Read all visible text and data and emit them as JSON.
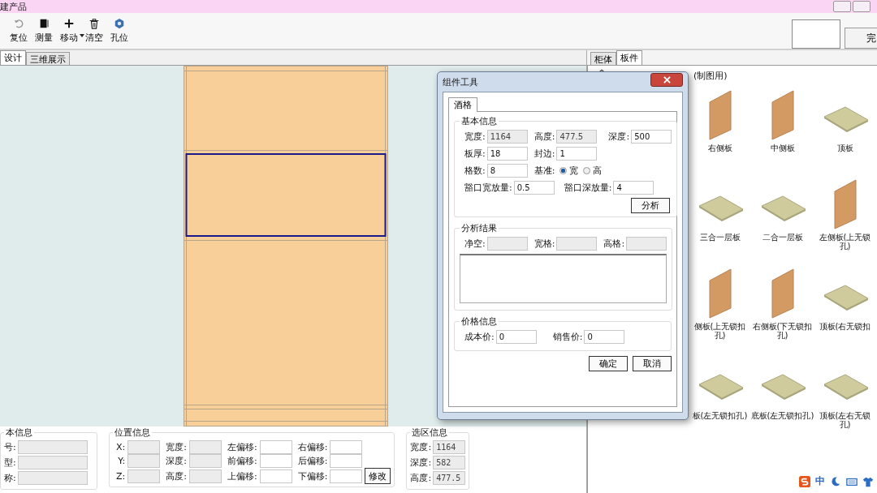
{
  "window": {
    "title": "建产品"
  },
  "toolbar": [
    {
      "label": "复位",
      "dropdown": false
    },
    {
      "label": "测量",
      "dropdown": false
    },
    {
      "label": "移动",
      "dropdown": true
    },
    {
      "label": "清空",
      "dropdown": false
    },
    {
      "label": "孔位",
      "dropdown": false
    }
  ],
  "top_right_button": "完",
  "design_tabs": [
    {
      "label": "设计",
      "selected": true
    },
    {
      "label": "三维展示",
      "selected": false
    }
  ],
  "library": {
    "tabs": [
      {
        "label": "柜体",
        "selected": false
      },
      {
        "label": "板件",
        "selected": true
      }
    ],
    "path": "(制图用)",
    "items": [
      {
        "kind": "side",
        "lines": [
          "右侧板"
        ]
      },
      {
        "kind": "side",
        "lines": [
          "中侧板"
        ]
      },
      {
        "kind": "flat",
        "lines": [
          "顶板"
        ]
      },
      {
        "kind": "flat",
        "lines": [
          "三合一层板"
        ]
      },
      {
        "kind": "flat",
        "lines": [
          "二合一层板"
        ]
      },
      {
        "kind": "side",
        "lines": [
          "左侧板(上无锁",
          "孔)"
        ]
      },
      {
        "kind": "side",
        "lines": [
          "侧板(上无锁扣",
          "孔)"
        ]
      },
      {
        "kind": "side",
        "lines": [
          "右侧板(下无锁扣",
          "孔)"
        ]
      },
      {
        "kind": "flat",
        "lines": [
          "顶板(右无锁扣"
        ]
      },
      {
        "kind": "flat",
        "lines": [
          "板(左无锁扣孔)"
        ]
      },
      {
        "kind": "flat",
        "lines": [
          "底板(左无锁扣孔)"
        ]
      },
      {
        "kind": "flat",
        "lines": [
          "顶板(左右无锁",
          "孔)"
        ]
      }
    ]
  },
  "dialog": {
    "title": "组件工具",
    "tab": "酒格",
    "basic": {
      "title": "基本信息",
      "width": {
        "label": "宽度:",
        "value": "1164",
        "disabled": true
      },
      "height": {
        "label": "高度:",
        "value": "477.5",
        "disabled": true
      },
      "depth": {
        "label": "深度:",
        "value": "500",
        "disabled": false
      },
      "thickness": {
        "label": "板厚:",
        "value": "18",
        "disabled": false
      },
      "edge": {
        "label": "封边:",
        "value": "1",
        "disabled": false
      },
      "count": {
        "label": "格数:",
        "value": "8",
        "disabled": false
      },
      "basis": {
        "label": "基准:",
        "options": [
          {
            "label": "宽",
            "selected": true
          },
          {
            "label": "高",
            "selected": false
          }
        ]
      },
      "notch_width": {
        "label": "豁口宽放量:",
        "value": "0.5",
        "disabled": false
      },
      "notch_depth": {
        "label": "豁口深放量:",
        "value": "4",
        "disabled": false
      },
      "analyze_button": "分析"
    },
    "result": {
      "title": "分析结果",
      "fields": [
        {
          "label": "净空:"
        },
        {
          "label": "宽格:"
        },
        {
          "label": "高格:"
        }
      ]
    },
    "price": {
      "title": "价格信息",
      "fields": [
        {
          "label": "成本价:",
          "value": "0"
        },
        {
          "label": "销售价:",
          "value": "0"
        }
      ]
    },
    "buttons": [
      "确定",
      "取消"
    ]
  },
  "basic_info": {
    "title": "本信息",
    "fields": [
      "号:",
      "型:",
      "称:"
    ]
  },
  "position_info": {
    "title": "位置信息",
    "rows": [
      [
        "X:",
        "宽度:",
        "左偏移:",
        "右偏移:"
      ],
      [
        "Y:",
        "深度:",
        "前偏移:",
        "后偏移:"
      ],
      [
        "Z:",
        "高度:",
        "上偏移:",
        "下偏移:"
      ]
    ],
    "button": "修改"
  },
  "selection_info": {
    "title": "选区信息",
    "fields": [
      {
        "label": "宽度:",
        "value": "1164"
      },
      {
        "label": "深度:",
        "value": "582"
      },
      {
        "label": "高度:",
        "value": "477.5"
      }
    ]
  },
  "tray": {
    "ime": "中"
  }
}
